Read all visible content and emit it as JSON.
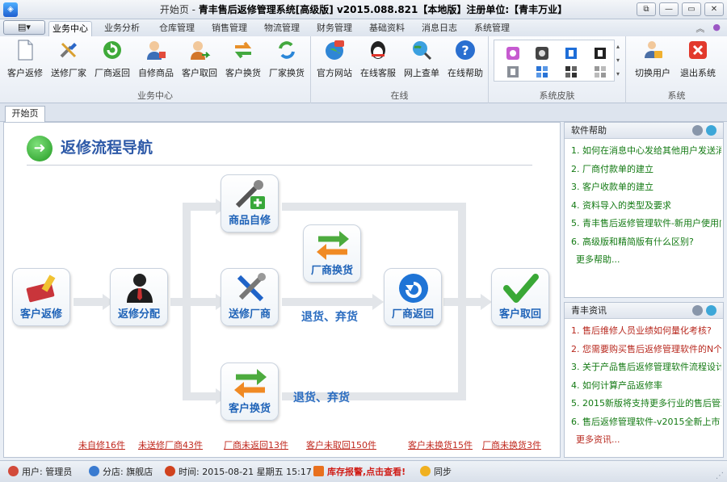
{
  "window": {
    "title_prefix": "开始页 -",
    "title_main": "青丰售后返修管理系统[高级版] v2015.088.821【本地版】注册单位:【青丰万业】",
    "buttons": [
      "⧉",
      "▭",
      "▭",
      "✕"
    ]
  },
  "menu_button": "▤▾",
  "tabs": [
    "业务中心",
    "业务分析",
    "仓库管理",
    "销售管理",
    "物流管理",
    "财务管理",
    "基础资料",
    "消息日志",
    "系统管理"
  ],
  "tabs_extra": [
    "︽",
    "●"
  ],
  "ribbon": {
    "groups": {
      "business": "业务中心",
      "online": "在线",
      "skin": "系统皮肤",
      "system": "系统"
    },
    "business_buttons": [
      "客户返修",
      "送修厂家",
      "厂商返回",
      "自修商品",
      "客户取回",
      "客户换货",
      "厂家换货"
    ],
    "online_buttons": [
      "官方网站",
      "在线客服",
      "网上查单",
      "在线帮助"
    ],
    "system_buttons": [
      "切换用户",
      "退出系统"
    ]
  },
  "doc_tab": "开始页",
  "flow": {
    "title": "返修流程导航",
    "nodes": {
      "customer_repair": "客户返修",
      "repair_assign": "返修分配",
      "self_repair": "商品自修",
      "send_vendor": "送修厂商",
      "vendor_exchange": "厂商换货",
      "vendor_return": "厂商返回",
      "customer_exchange": "客户换货",
      "customer_pickup": "客户取回"
    },
    "labels": {
      "return_discard_1": "退货、弃货",
      "return_discard_2": "退货、弃货"
    }
  },
  "bottom_links": [
    "未自修16件",
    "未送修厂商43件",
    "厂商未返回13件",
    "客户未取回150件",
    "客户未换货15件",
    "厂商未换货3件"
  ],
  "help_panel": {
    "title": "软件帮助",
    "items": [
      "1. 如何在消息中心发给其他用户发送消息",
      "2. 厂商付款单的建立",
      "3. 客户收款单的建立",
      "4. 资料导入的类型及要求",
      "5. 青丰售后返修管理软件-新用户使用向导",
      "6. 高级版和精简版有什么区别?"
    ],
    "more": "更多帮助..."
  },
  "news_panel": {
    "title": "青丰资讯",
    "items": [
      "1. 售后维修人员业绩如何量化考核?",
      "2. 您需要购买售后返修管理软件的N个理由",
      "3. 关于产品售后返修管理软件流程设计",
      "4. 如何计算产品返修率",
      "5. 2015新版将支持更多行业的售后管理",
      "6. 售后返修管理软件-v2015全新上市!"
    ],
    "more": "更多资讯..."
  },
  "status": {
    "user": "用户: 管理员",
    "branch": "分店: 旗舰店",
    "time": "时间: 2015-08-21 星期五 15:17",
    "alert": "库存报警,点击查看!",
    "sync": "同步"
  }
}
